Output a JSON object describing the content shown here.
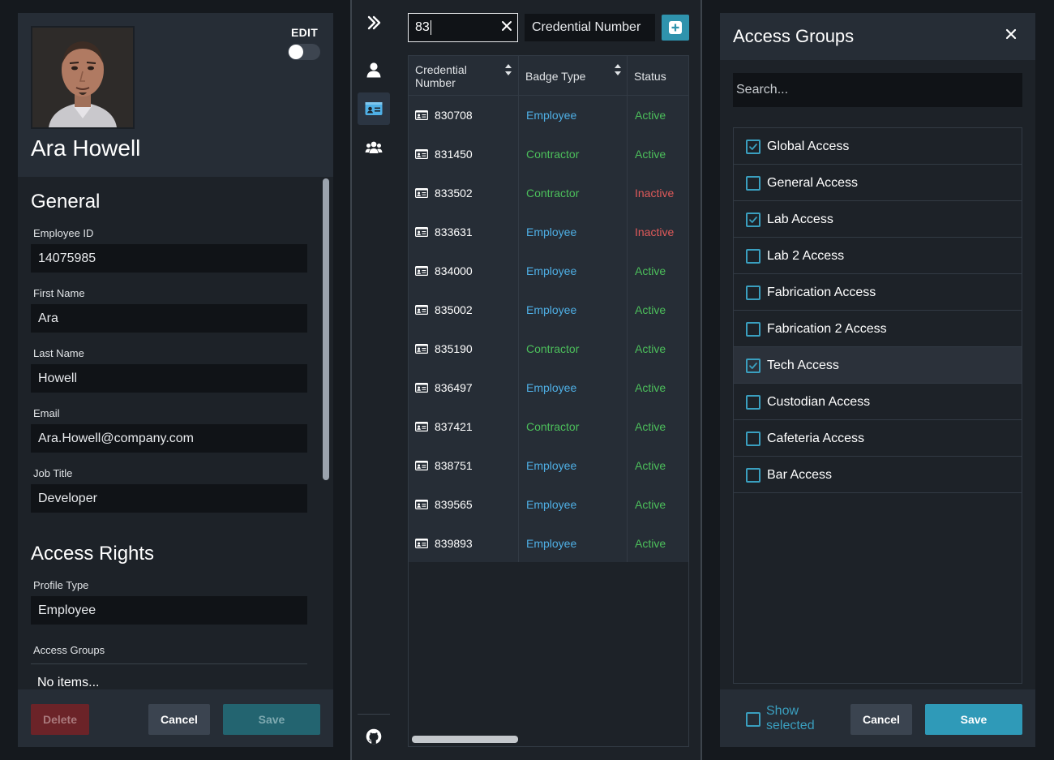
{
  "profile": {
    "edit_label": "EDIT",
    "edit_enabled": false,
    "name": "Ara Howell",
    "general": {
      "title": "General",
      "fields": [
        {
          "label": "Employee ID",
          "value": "14075985"
        },
        {
          "label": "First Name",
          "value": "Ara"
        },
        {
          "label": "Last Name",
          "value": "Howell"
        },
        {
          "label": "Email",
          "value": "Ara.Howell@company.com"
        },
        {
          "label": "Job Title",
          "value": "Developer"
        }
      ]
    },
    "access_rights": {
      "title": "Access Rights",
      "profile_type_label": "Profile Type",
      "profile_type_value": "Employee",
      "access_groups_label": "Access Groups",
      "access_groups_empty": "No items..."
    },
    "buttons": {
      "delete": "Delete",
      "cancel": "Cancel",
      "save": "Save"
    }
  },
  "nav": {
    "items": [
      {
        "icon": "chevrons-right-icon"
      },
      {
        "icon": "user-icon"
      },
      {
        "icon": "id-card-icon",
        "active": true
      },
      {
        "icon": "users-icon"
      },
      {
        "icon": "github-icon"
      }
    ]
  },
  "credentials": {
    "search_value": "83",
    "search_mode": "Credential Number",
    "columns": [
      "Credential Number",
      "Badge Type",
      "Status"
    ],
    "rows": [
      {
        "number": "830708",
        "badge": "Employee",
        "status": "Active"
      },
      {
        "number": "831450",
        "badge": "Contractor",
        "status": "Active"
      },
      {
        "number": "833502",
        "badge": "Contractor",
        "status": "Inactive"
      },
      {
        "number": "833631",
        "badge": "Employee",
        "status": "Inactive"
      },
      {
        "number": "834000",
        "badge": "Employee",
        "status": "Active"
      },
      {
        "number": "835002",
        "badge": "Employee",
        "status": "Active"
      },
      {
        "number": "835190",
        "badge": "Contractor",
        "status": "Active"
      },
      {
        "number": "836497",
        "badge": "Employee",
        "status": "Active"
      },
      {
        "number": "837421",
        "badge": "Contractor",
        "status": "Active"
      },
      {
        "number": "838751",
        "badge": "Employee",
        "status": "Active"
      },
      {
        "number": "839565",
        "badge": "Employee",
        "status": "Active"
      },
      {
        "number": "839893",
        "badge": "Employee",
        "status": "Active"
      }
    ]
  },
  "access_groups_dialog": {
    "title": "Access Groups",
    "search_placeholder": "Search...",
    "groups": [
      {
        "label": "Global Access",
        "checked": true
      },
      {
        "label": "General Access",
        "checked": false
      },
      {
        "label": "Lab Access",
        "checked": true
      },
      {
        "label": "Lab 2 Access",
        "checked": false
      },
      {
        "label": "Fabrication Access",
        "checked": false
      },
      {
        "label": "Fabrication 2 Access",
        "checked": false
      },
      {
        "label": "Tech Access",
        "checked": true,
        "highlighted": true
      },
      {
        "label": "Custodian Access",
        "checked": false
      },
      {
        "label": "Cafeteria Access",
        "checked": false
      },
      {
        "label": "Bar Access",
        "checked": false
      }
    ],
    "show_selected_label": "Show selected",
    "show_selected_checked": false,
    "buttons": {
      "cancel": "Cancel",
      "save": "Save"
    }
  },
  "colors": {
    "accent": "#2f9ab8",
    "employee": "#4fb0e6",
    "contractor": "#4cbf5b",
    "active": "#4cbf5b",
    "inactive": "#e05a5a",
    "delete": "#6b2328"
  }
}
